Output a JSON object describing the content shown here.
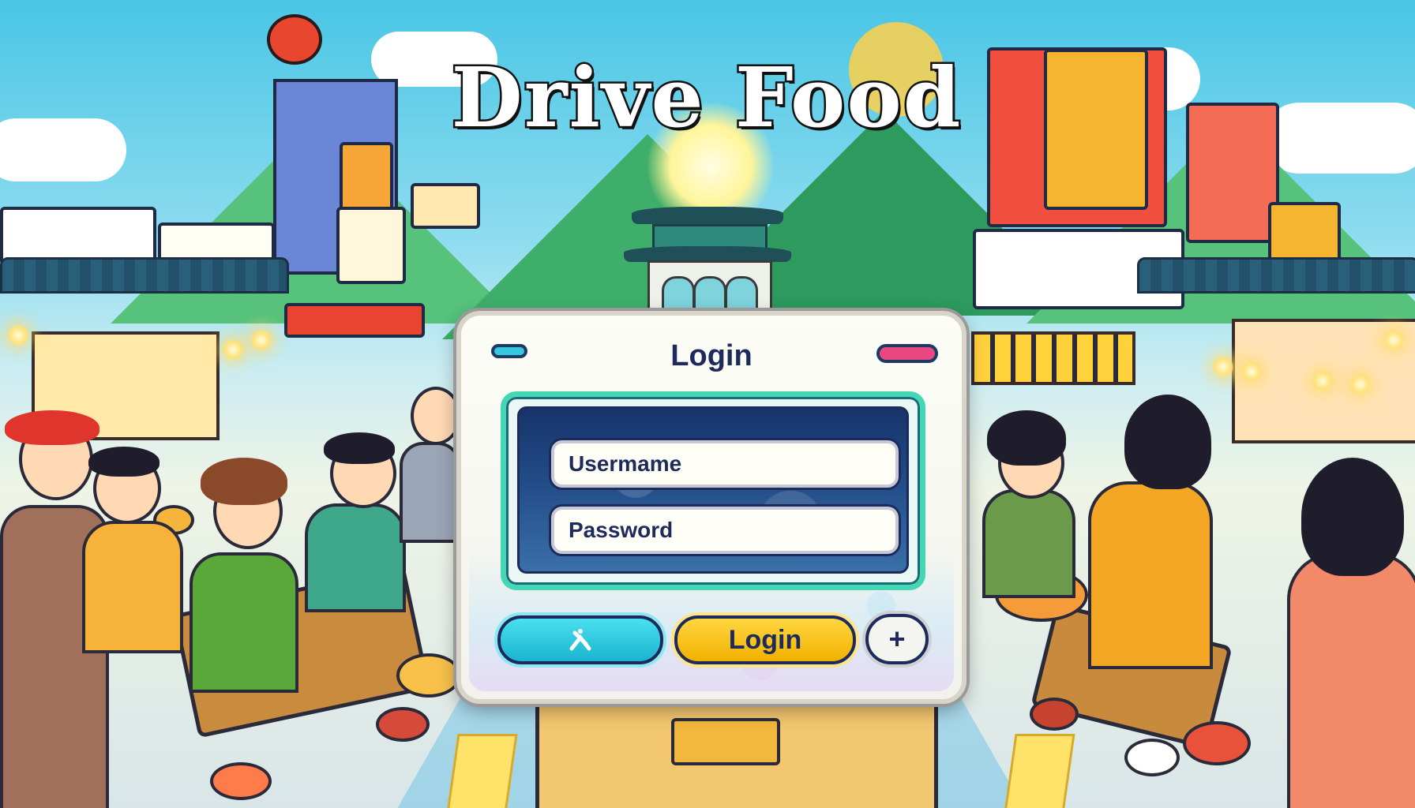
{
  "app": {
    "title": "Drive Food"
  },
  "login_dialog": {
    "title": "Login",
    "username": {
      "placeholder": "Usermame",
      "value": ""
    },
    "password": {
      "placeholder": "Password",
      "value": ""
    },
    "buttons": {
      "cancel_icon": "cross-icon",
      "login_label": "Login",
      "add_label": "+"
    }
  },
  "colors": {
    "accent_teal": "#45d6b3",
    "login_button": "#f2b100",
    "cancel_button": "#1bb3cf",
    "text_navy": "#1d2a5c"
  }
}
